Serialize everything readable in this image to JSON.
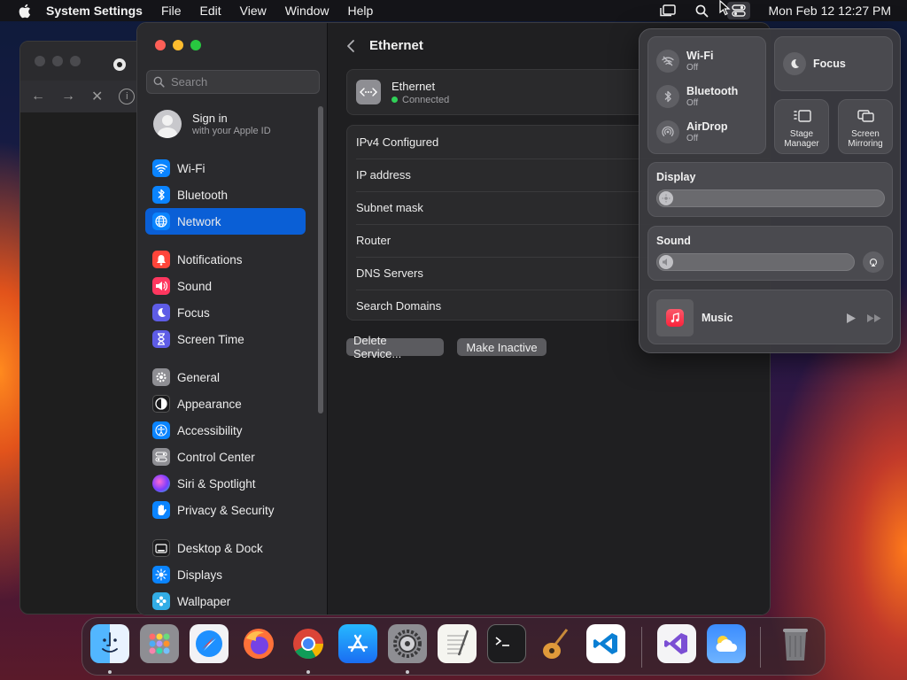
{
  "menubar": {
    "app_name": "System Settings",
    "menus": [
      "File",
      "Edit",
      "View",
      "Window",
      "Help"
    ],
    "clock": "Mon Feb 12  12:27 PM"
  },
  "search": {
    "placeholder": "Search"
  },
  "account": {
    "title": "Sign in",
    "subtitle": "with your Apple ID"
  },
  "sidebar": {
    "items": [
      {
        "label": "Wi-Fi",
        "icon": "wifi-icon",
        "color": "#0a84ff"
      },
      {
        "label": "Bluetooth",
        "icon": "bluetooth-icon",
        "color": "#0a84ff"
      },
      {
        "label": "Network",
        "icon": "globe-icon",
        "color": "#0a84ff",
        "active": true
      },
      {
        "label": "Notifications",
        "icon": "bell-icon",
        "color": "#ff453a"
      },
      {
        "label": "Sound",
        "icon": "speaker-icon",
        "color": "#ff375f"
      },
      {
        "label": "Focus",
        "icon": "moon-icon",
        "color": "#5e5ce6"
      },
      {
        "label": "Screen Time",
        "icon": "hourglass-icon",
        "color": "#5e5ce6"
      },
      {
        "label": "General",
        "icon": "gear-icon",
        "color": "#8e8e93"
      },
      {
        "label": "Appearance",
        "icon": "appearance-icon",
        "color": "#1c1c1e"
      },
      {
        "label": "Accessibility",
        "icon": "accessibility-icon",
        "color": "#0a84ff"
      },
      {
        "label": "Control Center",
        "icon": "control-center-icon",
        "color": "#8e8e93"
      },
      {
        "label": "Siri & Spotlight",
        "icon": "siri-icon",
        "color": "#bf5af2"
      },
      {
        "label": "Privacy & Security",
        "icon": "hand-icon",
        "color": "#0a84ff"
      },
      {
        "label": "Desktop & Dock",
        "icon": "dock-icon",
        "color": "#1c1c1e"
      },
      {
        "label": "Displays",
        "icon": "sun-icon",
        "color": "#0a84ff"
      },
      {
        "label": "Wallpaper",
        "icon": "flower-icon",
        "color": "#32ade6"
      }
    ]
  },
  "main": {
    "title": "Ethernet",
    "service": {
      "name": "Ethernet",
      "status": "Connected",
      "status_color": "#30d158"
    },
    "details": [
      "IPv4 Configured",
      "IP address",
      "Subnet mask",
      "Router",
      "DNS Servers",
      "Search Domains"
    ],
    "buttons": {
      "delete": "Delete Service...",
      "inactive": "Make Inactive"
    }
  },
  "control_center": {
    "wifi": {
      "label": "Wi-Fi",
      "state": "Off"
    },
    "bluetooth": {
      "label": "Bluetooth",
      "state": "Off"
    },
    "airdrop": {
      "label": "AirDrop",
      "state": "Off"
    },
    "focus": {
      "label": "Focus"
    },
    "stage_manager": {
      "line1": "Stage",
      "line2": "Manager"
    },
    "screen_mirroring": {
      "line1": "Screen",
      "line2": "Mirroring"
    },
    "display": {
      "label": "Display",
      "level": 0.0
    },
    "sound": {
      "label": "Sound",
      "level": 0.0
    },
    "music": {
      "label": "Music"
    }
  },
  "dock": {
    "apps": [
      "finder-icon",
      "launchpad-icon",
      "safari-icon",
      "firefox-icon",
      "chrome-icon",
      "app-store-icon",
      "system-settings-icon",
      "textedit-icon",
      "terminal-icon",
      "garageband-icon",
      "vscode-icon",
      "visual-studio-icon",
      "weather-icon",
      "trash-icon"
    ]
  }
}
